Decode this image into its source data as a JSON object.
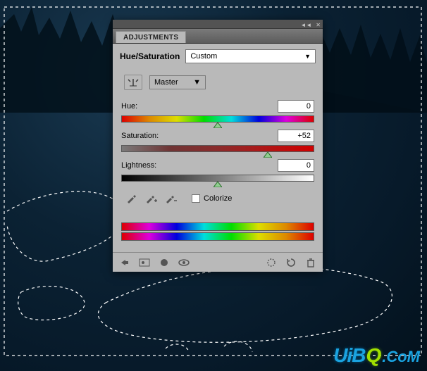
{
  "panel": {
    "tab": "ADJUSTMENTS",
    "title": "Hue/Saturation",
    "preset": "Custom",
    "scope": "Master",
    "sliders": {
      "hue": {
        "label": "Hue:",
        "value": "0",
        "pos_pct": 50
      },
      "saturation": {
        "label": "Saturation:",
        "value": "+52",
        "pos_pct": 76
      },
      "lightness": {
        "label": "Lightness:",
        "value": "0",
        "pos_pct": 50
      }
    },
    "colorize_label": "Colorize",
    "colorize_checked": false,
    "icons": {
      "targeted": "targeted-adjust-icon",
      "eyedroppers": [
        "eyedropper-icon",
        "eyedropper-add-icon",
        "eyedropper-subtract-icon"
      ],
      "footer_left": [
        "back-icon",
        "adjust-thumb-icon",
        "clip-mask-icon",
        "eye-icon"
      ],
      "footer_right": [
        "preset-menu-icon",
        "reset-icon",
        "trash-icon"
      ]
    }
  },
  "watermark": {
    "a": "UiB",
    "b": "Q",
    "c": ".CoM"
  }
}
